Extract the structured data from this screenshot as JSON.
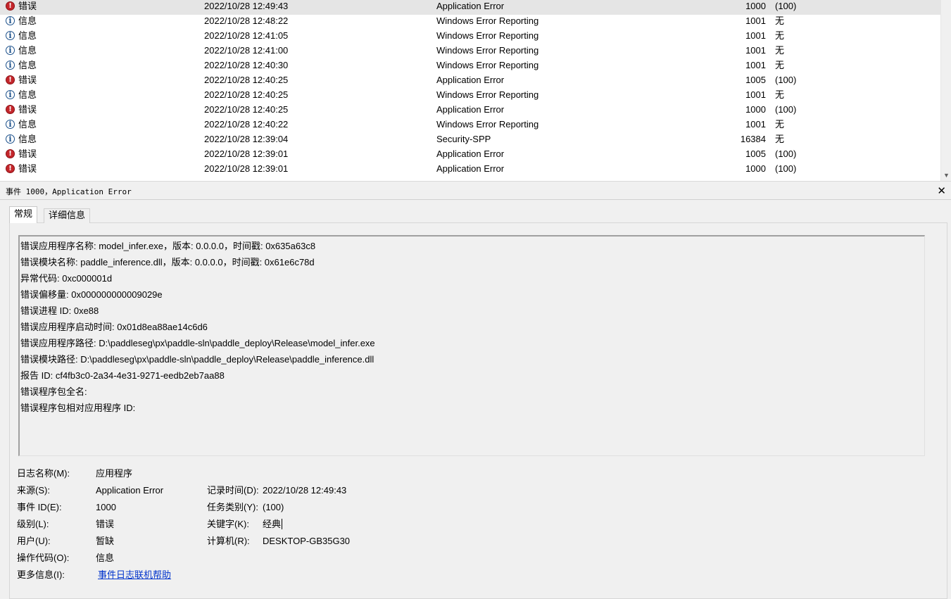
{
  "event_list": {
    "rows": [
      {
        "level": "错误",
        "type": "error",
        "date": "2022/10/28 12:49:43",
        "source": "Application Error",
        "event_id": "1000",
        "task": "(100)",
        "selected": true
      },
      {
        "level": "信息",
        "type": "info",
        "date": "2022/10/28 12:48:22",
        "source": "Windows Error Reporting",
        "event_id": "1001",
        "task": "无"
      },
      {
        "level": "信息",
        "type": "info",
        "date": "2022/10/28 12:41:05",
        "source": "Windows Error Reporting",
        "event_id": "1001",
        "task": "无"
      },
      {
        "level": "信息",
        "type": "info",
        "date": "2022/10/28 12:41:00",
        "source": "Windows Error Reporting",
        "event_id": "1001",
        "task": "无"
      },
      {
        "level": "信息",
        "type": "info",
        "date": "2022/10/28 12:40:30",
        "source": "Windows Error Reporting",
        "event_id": "1001",
        "task": "无"
      },
      {
        "level": "错误",
        "type": "error",
        "date": "2022/10/28 12:40:25",
        "source": "Application Error",
        "event_id": "1005",
        "task": "(100)"
      },
      {
        "level": "信息",
        "type": "info",
        "date": "2022/10/28 12:40:25",
        "source": "Windows Error Reporting",
        "event_id": "1001",
        "task": "无"
      },
      {
        "level": "错误",
        "type": "error",
        "date": "2022/10/28 12:40:25",
        "source": "Application Error",
        "event_id": "1000",
        "task": "(100)"
      },
      {
        "level": "信息",
        "type": "info",
        "date": "2022/10/28 12:40:22",
        "source": "Windows Error Reporting",
        "event_id": "1001",
        "task": "无"
      },
      {
        "level": "信息",
        "type": "info",
        "date": "2022/10/28 12:39:04",
        "source": "Security-SPP",
        "event_id": "16384",
        "task": "无"
      },
      {
        "level": "错误",
        "type": "error",
        "date": "2022/10/28 12:39:01",
        "source": "Application Error",
        "event_id": "1005",
        "task": "(100)"
      },
      {
        "level": "错误",
        "type": "error",
        "date": "2022/10/28 12:39:01",
        "source": "Application Error",
        "event_id": "1000",
        "task": "(100)"
      }
    ]
  },
  "detail": {
    "title": "事件 1000，Application Error",
    "close_symbol": "✕",
    "tabs": [
      {
        "label": "常规",
        "active": true
      },
      {
        "label": "详细信息",
        "active": false
      }
    ],
    "description_lines": [
      "错误应用程序名称: model_infer.exe，版本: 0.0.0.0，时间戳: 0x635a63c8",
      "错误模块名称: paddle_inference.dll，版本: 0.0.0.0，时间戳: 0x61e6c78d",
      "异常代码: 0xc000001d",
      "错误偏移量: 0x000000000009029e",
      "错误进程 ID: 0xe88",
      "错误应用程序启动时间: 0x01d8ea88ae14c6d6",
      "错误应用程序路径: D:\\paddleseg\\px\\paddle-sln\\paddle_deploy\\Release\\model_infer.exe",
      "错误模块路径: D:\\paddleseg\\px\\paddle-sln\\paddle_deploy\\Release\\paddle_inference.dll",
      "报告 ID: cf4fb3c0-2a34-4e31-9271-eedb2eb7aa88",
      "错误程序包全名:",
      "错误程序包相对应用程序 ID:"
    ],
    "props": {
      "log_name_label": "日志名称(M):",
      "log_name_value": "应用程序",
      "source_label": "来源(S):",
      "source_value": "Application Error",
      "logged_label": "记录时间(D):",
      "logged_value": "2022/10/28 12:49:43",
      "event_id_label": "事件 ID(E):",
      "event_id_value": "1000",
      "task_label": "任务类别(Y):",
      "task_value": "(100)",
      "level_label": "级别(L):",
      "level_value": "错误",
      "keywords_label": "关键字(K):",
      "keywords_value": "经典",
      "user_label": "用户(U):",
      "user_value": "暂缺",
      "computer_label": "计算机(R):",
      "computer_value": "DESKTOP-GB35G30",
      "opcode_label": "操作代码(O):",
      "opcode_value": "信息",
      "more_info_label": "更多信息(I):",
      "more_info_link": "事件日志联机帮助"
    }
  }
}
